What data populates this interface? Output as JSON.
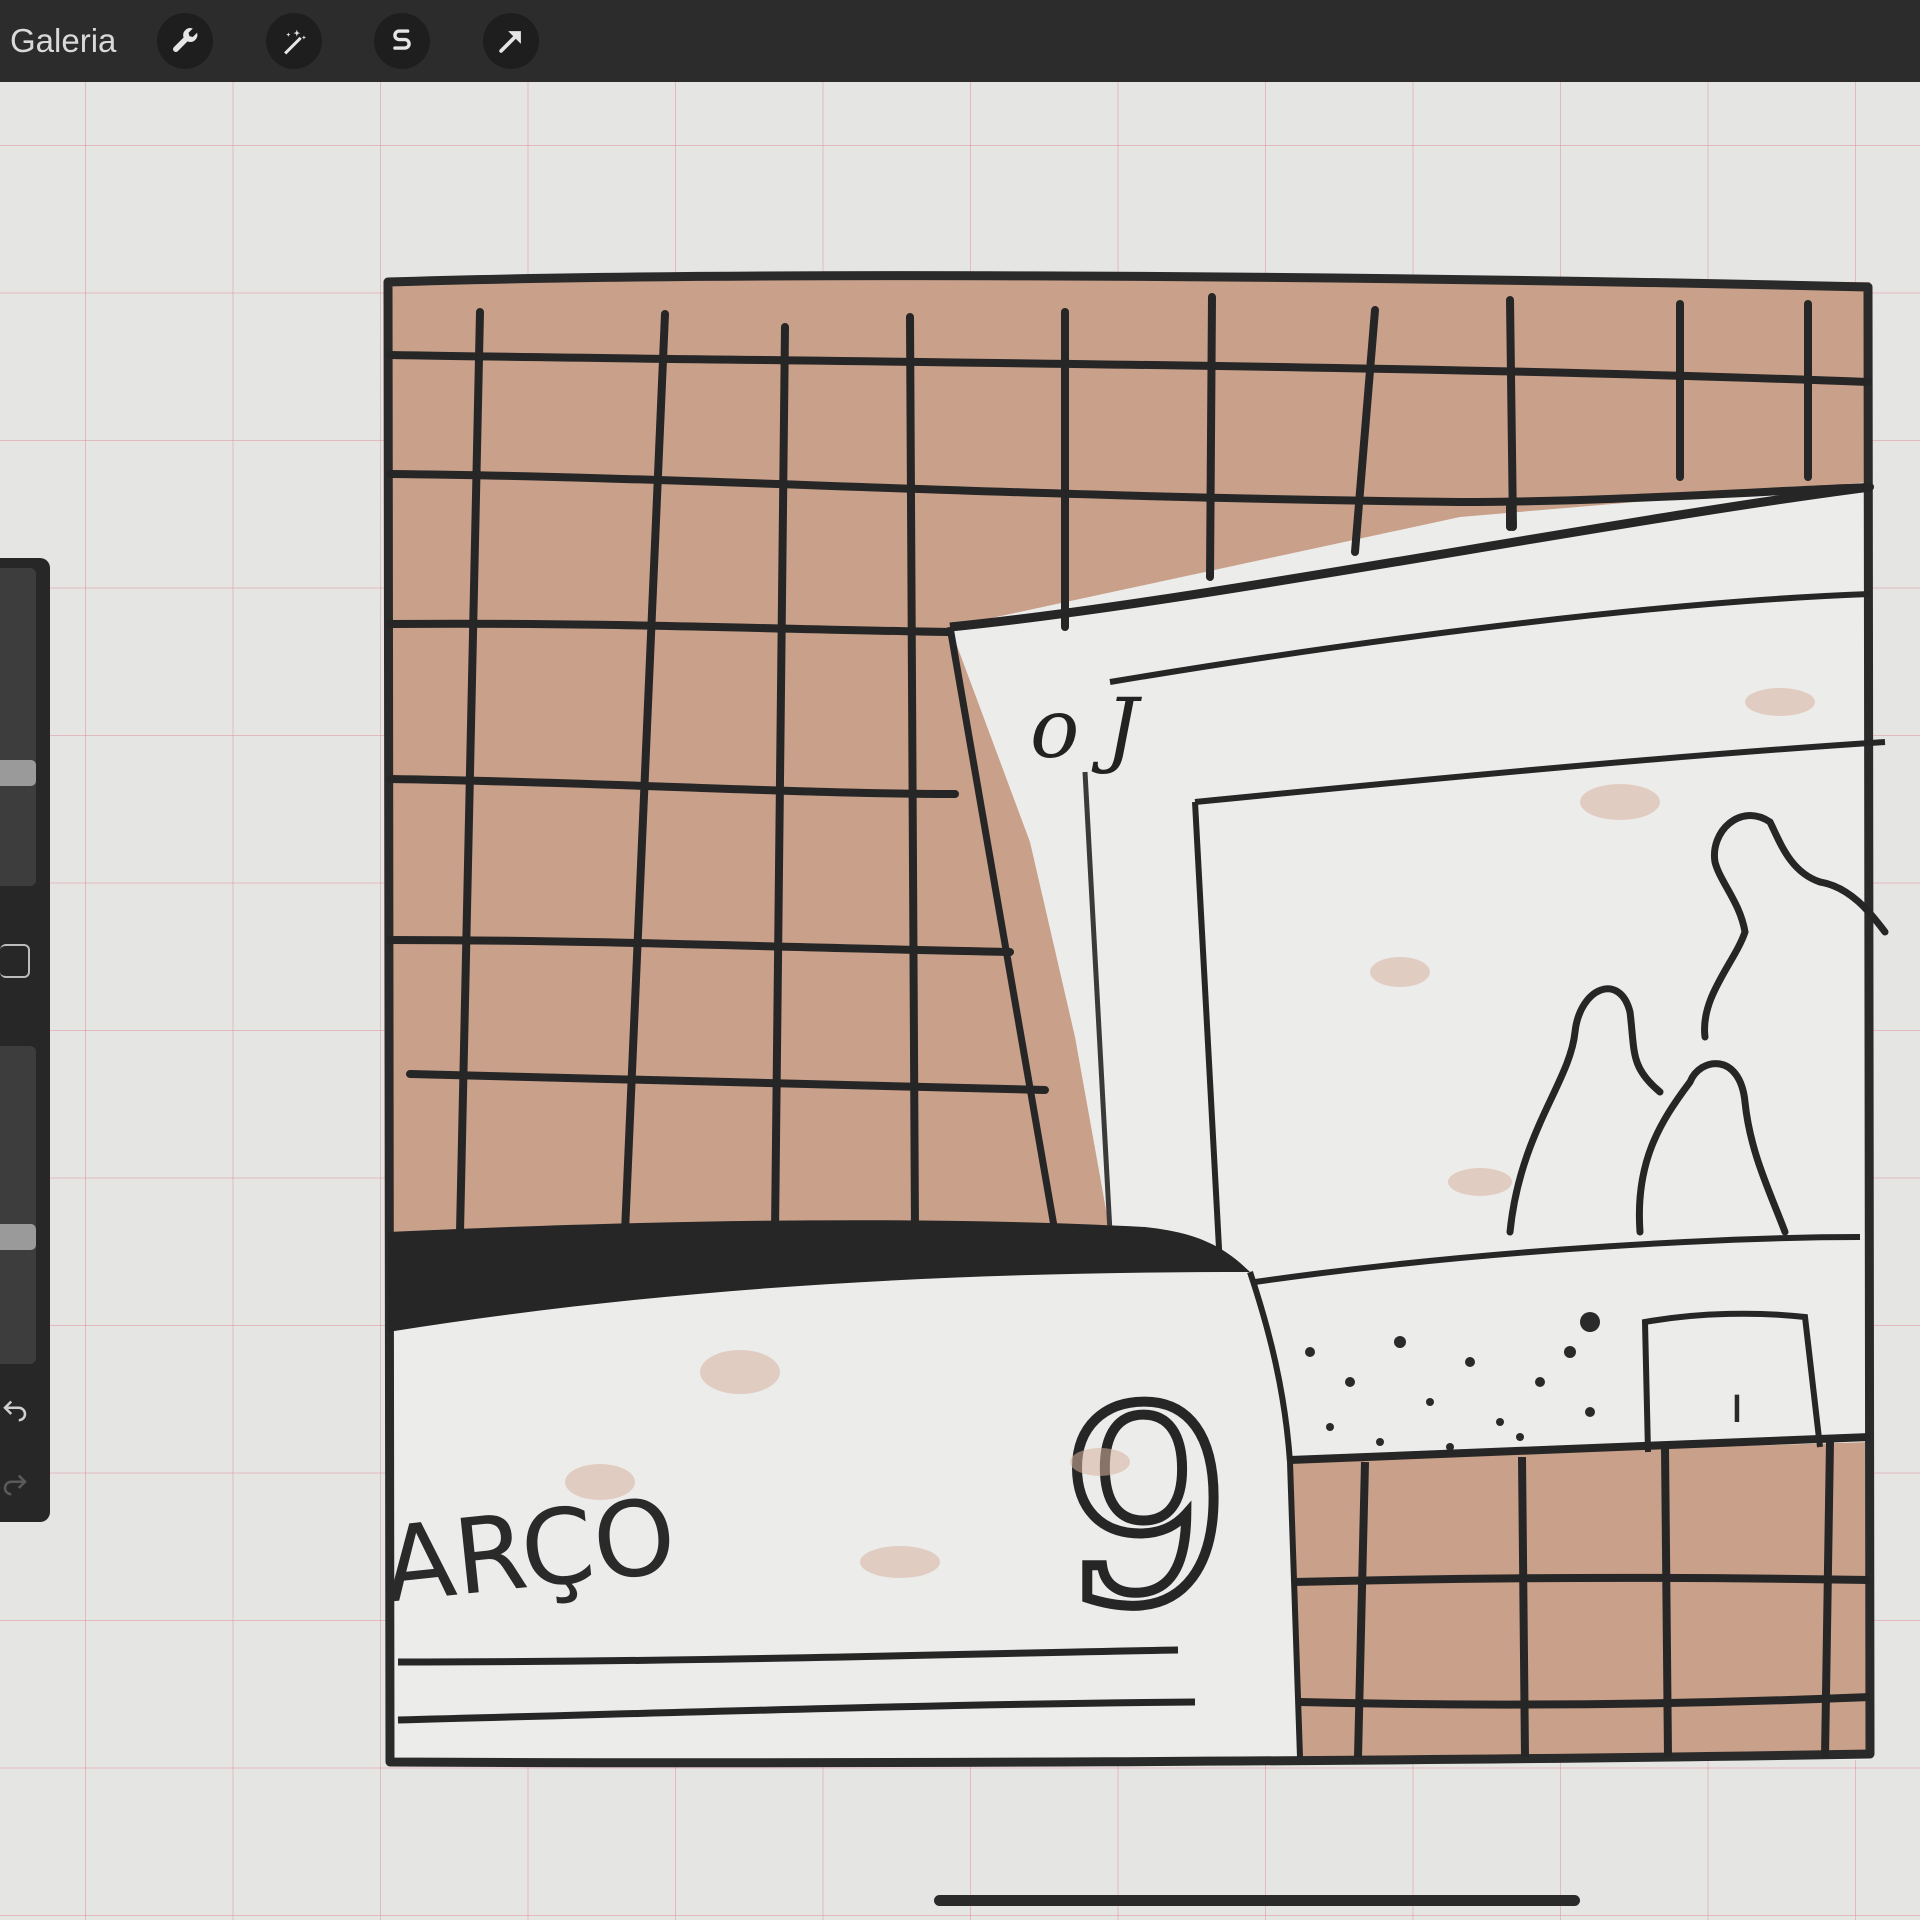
{
  "toolbar": {
    "gallery_label": "Galeria",
    "tools": [
      "wrench-icon",
      "magic-wand-icon",
      "selection-s-icon",
      "transform-arrow-icon"
    ]
  },
  "sidebar": {
    "brush_size_level": 0.5,
    "opacity_level": 0.45,
    "icons": [
      "undo-icon",
      "redo-icon"
    ]
  },
  "artwork": {
    "sign_text": "ARÇO",
    "big_number": "9",
    "colors": {
      "terracotta": "#c9a08a",
      "ink": "#2a2a2a",
      "paper": "#ededeb"
    }
  }
}
